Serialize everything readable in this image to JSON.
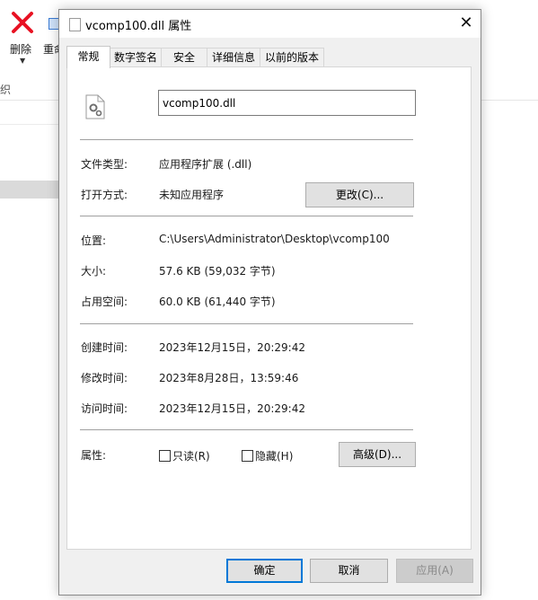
{
  "background": {
    "ribbon": {
      "delete_label": "删除",
      "rename_label": "重命",
      "group_label": "织"
    }
  },
  "dialog": {
    "title": "vcomp100.dll 属性",
    "close_glyph": "✕",
    "tabs": [
      {
        "label": "常规",
        "active": true
      },
      {
        "label": "数字签名",
        "active": false
      },
      {
        "label": "安全",
        "active": false
      },
      {
        "label": "详细信息",
        "active": false
      },
      {
        "label": "以前的版本",
        "active": false
      }
    ],
    "general": {
      "file_name": "vcomp100.dll",
      "file_type_label": "文件类型:",
      "file_type_value": "应用程序扩展 (.dll)",
      "open_with_label": "打开方式:",
      "open_with_value": "未知应用程序",
      "change_button": "更改(C)...",
      "location_label": "位置:",
      "location_value": "C:\\Users\\Administrator\\Desktop\\vcomp100",
      "size_label": "大小:",
      "size_value": "57.6 KB (59,032 字节)",
      "size_on_disk_label": "占用空间:",
      "size_on_disk_value": "60.0 KB (61,440 字节)",
      "created_label": "创建时间:",
      "created_value": "2023年12月15日，20:29:42",
      "modified_label": "修改时间:",
      "modified_value": "2023年8月28日，13:59:46",
      "accessed_label": "访问时间:",
      "accessed_value": "2023年12月15日，20:29:42",
      "attributes_label": "属性:",
      "readonly_label": "只读(R)",
      "readonly_checked": false,
      "hidden_label": "隐藏(H)",
      "hidden_checked": false,
      "advanced_button": "高级(D)..."
    },
    "footer": {
      "ok": "确定",
      "cancel": "取消",
      "apply": "应用(A)"
    }
  },
  "colors": {
    "accent": "#0078d7",
    "dialog_bg": "#f0f0f0",
    "panel_bg": "#ffffff",
    "delete_icon": "#e81123"
  },
  "icons": [
    "delete-x-icon",
    "rename-icon",
    "dll-file-icon",
    "close-icon",
    "gear-file-icon"
  ]
}
